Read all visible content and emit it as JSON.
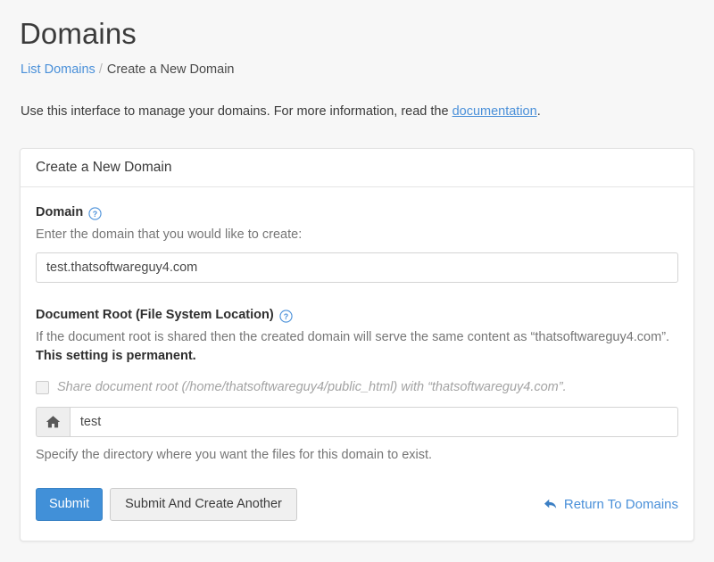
{
  "page": {
    "title": "Domains",
    "breadcrumb": {
      "link_label": "List Domains",
      "separator": "/",
      "current": "Create a New Domain"
    },
    "intro": {
      "text_before": "Use this interface to manage your domains. For more information, read the ",
      "link_label": "documentation",
      "text_after": "."
    }
  },
  "panel": {
    "heading": "Create a New Domain",
    "domain_field": {
      "label": "Domain",
      "help_icon": "question-circle-icon",
      "description": "Enter the domain that you would like to create:",
      "value": "test.thatsoftwareguy4.com",
      "placeholder": ""
    },
    "document_root_field": {
      "label": "Document Root (File System Location)",
      "help_icon": "question-circle-icon",
      "description_normal": "If the document root is shared then the created domain will serve the same content as “thatsoftwareguy4.com”.",
      "description_strong": "This setting is permanent.",
      "share_checkbox": {
        "label": "Share document root (/home/thatsoftwareguy4/public_html) with “thatsoftwareguy4.com”.",
        "checked": false,
        "disabled": true
      },
      "addon_icon": "home-icon",
      "value": "test",
      "placeholder": "",
      "hint": "Specify the directory where you want the files for this domain to exist."
    },
    "actions": {
      "submit_label": "Submit",
      "submit_another_label": "Submit And Create Another",
      "return_link_label": "Return To Domains",
      "return_icon": "arrow-back-icon"
    }
  },
  "colors": {
    "accent": "#4a90d9",
    "primary_button": "#4190d8",
    "page_background": "#f7f7f7",
    "panel_background": "#ffffff",
    "muted_text": "#767676"
  }
}
